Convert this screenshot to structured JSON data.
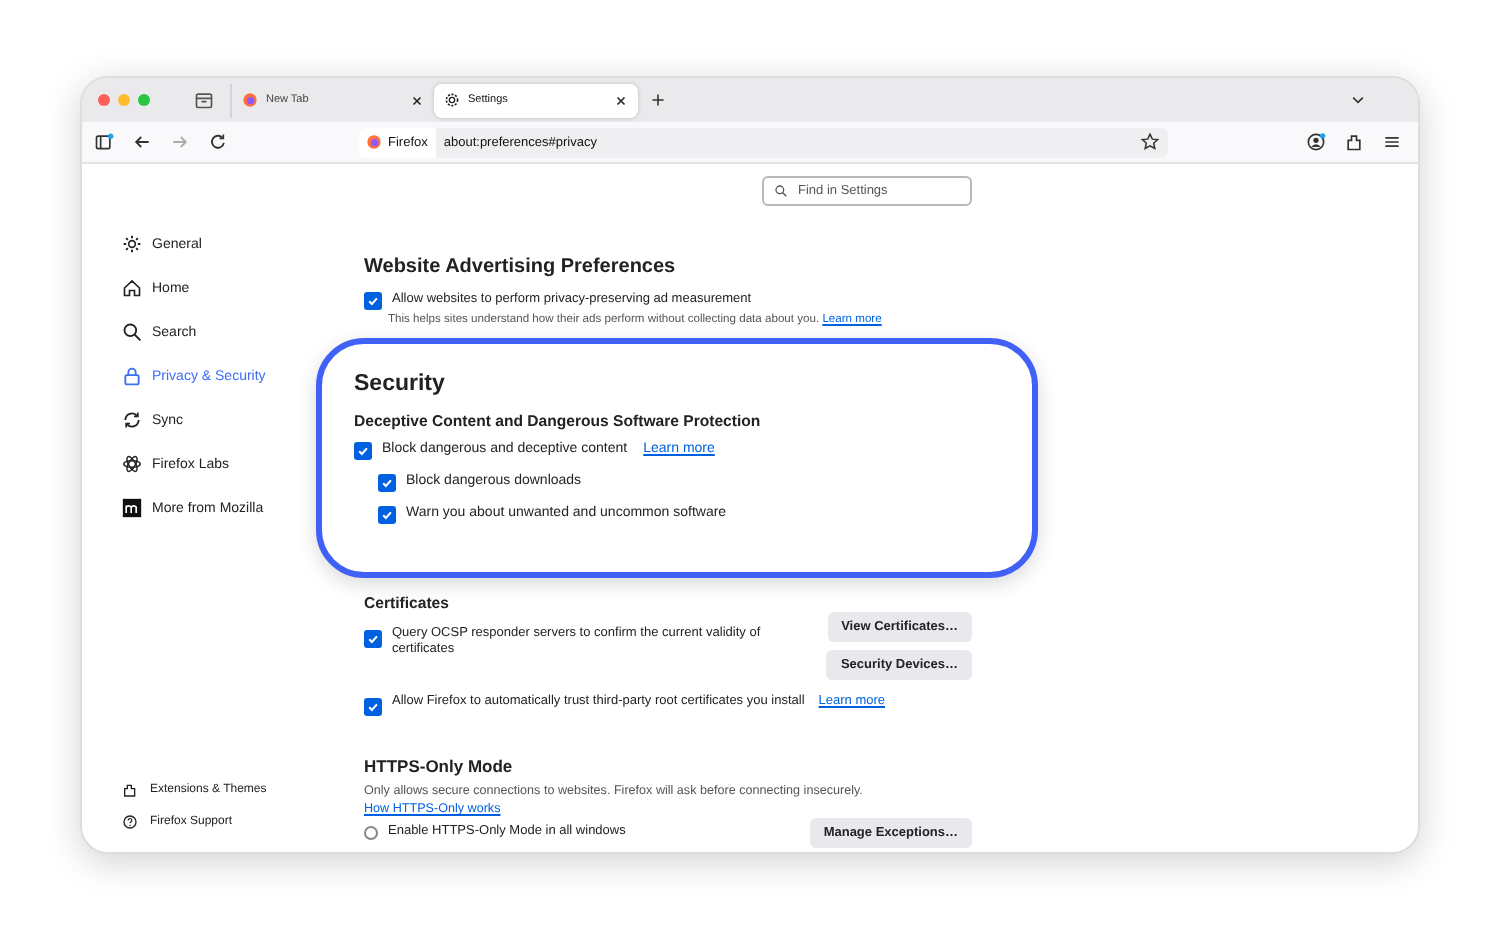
{
  "tabs": [
    {
      "label": "New Tab",
      "selected": false
    },
    {
      "label": "Settings",
      "selected": true
    }
  ],
  "toolbar": {
    "identity": "Firefox",
    "url": "about:preferences#privacy"
  },
  "search": {
    "placeholder": "Find in Settings"
  },
  "sidebar": {
    "items": [
      {
        "label": "General",
        "selected": false
      },
      {
        "label": "Home",
        "selected": false
      },
      {
        "label": "Search",
        "selected": false
      },
      {
        "label": "Privacy & Security",
        "selected": true
      },
      {
        "label": "Sync",
        "selected": false
      },
      {
        "label": "Firefox Labs",
        "selected": false
      },
      {
        "label": "More from Mozilla",
        "selected": false
      }
    ],
    "footer": [
      "Extensions & Themes",
      "Firefox Support"
    ]
  },
  "advertising": {
    "title": "Website Advertising Preferences",
    "option": {
      "label": "Allow websites to perform privacy-preserving ad measurement",
      "checked": true
    },
    "help": "This helps sites understand how their ads perform without collecting data about you.",
    "link": "Learn more"
  },
  "security": {
    "title": "Security",
    "subtitle": "Deceptive Content and Dangerous Software Protection",
    "options": [
      {
        "label": "Block dangerous and deceptive content",
        "checked": true,
        "link": "Learn more",
        "children": [
          {
            "label": "Block dangerous downloads",
            "checked": true
          },
          {
            "label": "Warn you about unwanted and uncommon software",
            "checked": true
          }
        ]
      }
    ]
  },
  "certificates": {
    "title": "Certificates",
    "options": [
      {
        "label": "Query OCSP responder servers to confirm the current validity of certificates",
        "checked": true,
        "buttons": [
          "View Certificates…",
          "Security Devices…"
        ]
      },
      {
        "label": "Allow Firefox to automatically trust third-party root certificates you install",
        "checked": true,
        "link": "Learn more"
      }
    ]
  },
  "https_only": {
    "title": "HTTPS-Only Mode",
    "description": "Only allows secure connections to websites. Firefox will ask before connecting insecurely.",
    "link": "How HTTPS-Only works",
    "modes": [
      {
        "label": "Enable HTTPS-Only Mode in all windows",
        "selected": false
      }
    ],
    "button": "Manage Exceptions…"
  }
}
